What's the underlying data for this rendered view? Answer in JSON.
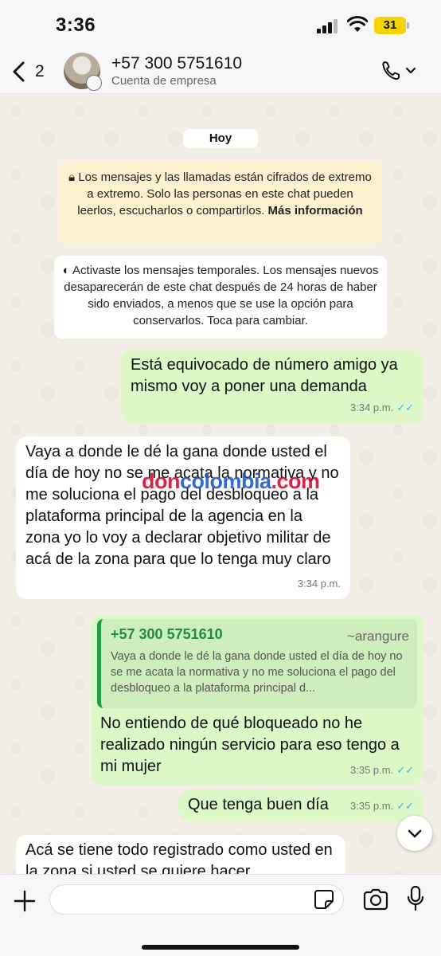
{
  "status_bar": {
    "time": "3:36",
    "battery": "31"
  },
  "header": {
    "back_count": "2",
    "contact_name": "+57 300 5751610",
    "contact_subtitle": "Cuenta de empresa"
  },
  "chat": {
    "date_label": "Hoy",
    "encryption_notice": {
      "text": "Los mensajes y las llamadas están cifrados de extremo a extremo. Solo las personas en este chat pueden leerlos, escucharlos o compartirlos.",
      "link": "Más información"
    },
    "temporary_notice": "Activaste los mensajes temporales. Los mensajes nuevos desaparecerán de este chat después de 24 horas de haber sido enviados, a menos que se use la opción para conservarlos. Toca para cambiar.",
    "messages": [
      {
        "direction": "out",
        "text": "Está equivocado de número amigo ya mismo voy a poner una demanda",
        "time": "3:34 p.m.",
        "read": true
      },
      {
        "direction": "in",
        "text": "Vaya a donde le dé la gana donde usted el día de hoy no se me acata la normativa y no me soluciona el pago del desbloqueo a la plataforma principal de la agencia en la zona yo lo voy a declarar objetivo militar de acá de la zona para que lo tenga muy claro",
        "time": "3:34 p.m."
      },
      {
        "direction": "out",
        "quote": {
          "name": "+57 300 5751610",
          "alias": "~arangure",
          "text": "Vaya a donde le dé la gana donde usted el día de hoy no se me acata la normativa y no me soluciona el pago del desbloqueo a la plataforma principal d..."
        },
        "text": "No entiendo de qué bloqueado no he realizado ningún servicio para eso tengo a mi mujer",
        "time": "3:35 p.m.",
        "read": true
      },
      {
        "direction": "out",
        "text": "Que tenga buen día",
        "time": "3:35 p.m.",
        "read": true
      },
      {
        "direction": "in",
        "text": "Acá se tiene todo registrado como usted en la zona si usted se quiere hacer"
      }
    ],
    "watermark": {
      "part1": "don",
      "part2": "colombia",
      "part3": ".com"
    }
  },
  "input": {
    "placeholder": "",
    "value": ""
  },
  "icons": [
    "chevron-left-icon",
    "phone-icon",
    "chevron-down-icon",
    "lock-icon",
    "timer-icon",
    "double-check-icon",
    "plus-icon",
    "sticker-icon",
    "camera-icon",
    "microphone-icon"
  ],
  "colors": {
    "outgoing_bubble": "#dcf8c6",
    "incoming_bubble": "#ffffff",
    "read_ticks": "#34b7f1",
    "quote_accent": "#1f9b4d",
    "wallpaper": "#f4efe6"
  }
}
